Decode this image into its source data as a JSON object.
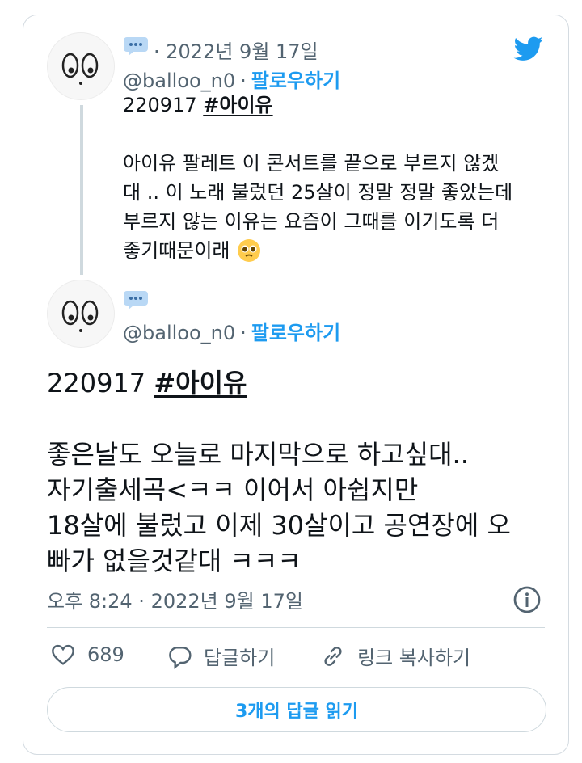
{
  "reply_tweet": {
    "date": "· 2022년 9월 17일",
    "handle": "@balloo_n0",
    "separator": "·",
    "follow_label": "팔로우하기",
    "line1_prefix": "220917 ",
    "hashtag": "#아이유",
    "body_lines": [
      "아이유 팔레트 이 콘서트를 끝으로 부르지 않겠",
      "대 .. 이 노래 불렀던 25살이 정말 정말 좋았는데",
      "부르지 않는 이유는 요즘이 그때를 이기도록 더",
      "좋기때문이래"
    ]
  },
  "main_tweet": {
    "handle": "@balloo_n0",
    "separator": "·",
    "follow_label": "팔로우하기",
    "line1_prefix": "220917 ",
    "hashtag": "#아이유",
    "body_lines": [
      "좋은날도 오늘로 마지막으로 하고싶대..",
      "자기출세곡<ㅋㅋ 이어서 아쉽지만",
      "18살에 불렀고 이제 30살이고 공연장에 오",
      "빠가 없을것같대 ㅋㅋㅋ"
    ],
    "timestamp": "오후 8:24 · 2022년 9월 17일"
  },
  "actions": {
    "like_count": "689",
    "reply_label": "답글하기",
    "copy_link_label": "링크 복사하기"
  },
  "read_replies_label": "3개의 답글 읽기",
  "colors": {
    "accent": "#1d9bf0",
    "text": "#0f1419",
    "muted": "#536471",
    "border": "#cfd9de"
  },
  "icons": [
    "speech-bubble-dots-icon",
    "twitter-bird-icon",
    "info-icon",
    "heart-icon",
    "reply-icon",
    "link-icon",
    "pleading-face-emoji"
  ]
}
